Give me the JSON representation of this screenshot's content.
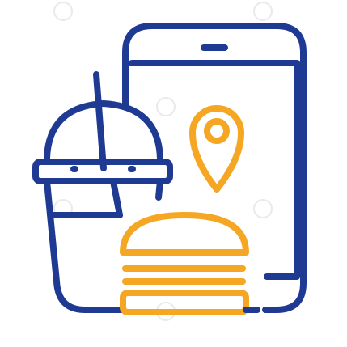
{
  "icon": {
    "name": "food-delivery-app-icon",
    "parts": [
      "smartphone-icon",
      "location-pin-icon",
      "burger-icon",
      "drink-cup-icon"
    ]
  },
  "colors": {
    "primary": "#1f3a93",
    "accent": "#f5a623",
    "background": "#ffffff",
    "watermark": "#e9e9ee"
  }
}
